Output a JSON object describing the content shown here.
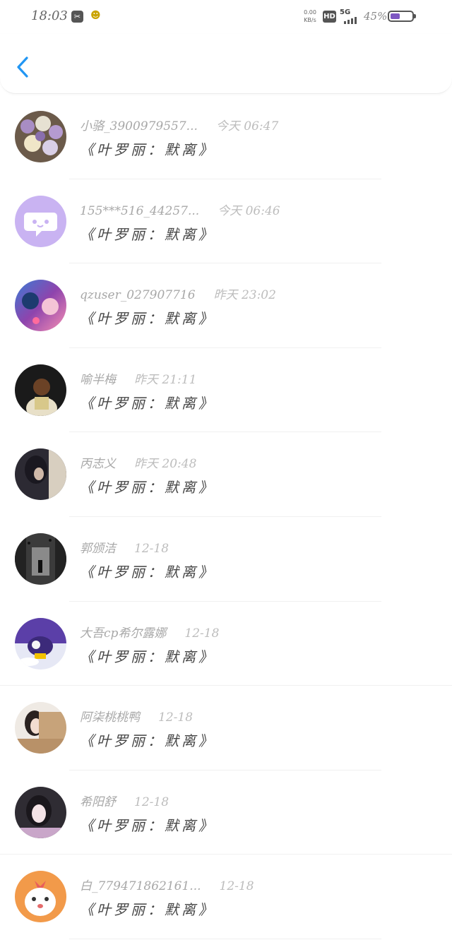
{
  "status_bar": {
    "time": "18:03",
    "network_speed": "0.00",
    "network_unit": "KB/s",
    "hd": "HD",
    "signal": "5G",
    "battery": "45%",
    "battery_level": 0.45
  },
  "header": {
    "back_icon": "chevron-left-icon",
    "accent_color": "#2196f3"
  },
  "messages": [
    {
      "name": "小骆_3900979557...",
      "time": "今天 06:47",
      "text": "《叶罗丽：默离》"
    },
    {
      "name": "155***516_44257...",
      "time": "今天 06:46",
      "text": "《叶罗丽：默离》"
    },
    {
      "name": "qzuser_027907716",
      "time": "昨天 23:02",
      "text": "《叶罗丽：默离》"
    },
    {
      "name": "喻半梅",
      "time": "昨天 21:11",
      "text": "《叶罗丽：默离》"
    },
    {
      "name": "丙志义",
      "time": "昨天 20:48",
      "text": "《叶罗丽：默离》"
    },
    {
      "name": "郭颁洁",
      "time": "12-18",
      "text": "《叶罗丽：默离》"
    },
    {
      "name": "大吾cp希尔露娜",
      "time": "12-18",
      "text": "《叶罗丽：默离》"
    },
    {
      "name": "阿柒桃桃鸭",
      "time": "12-18",
      "text": "《叶罗丽：默离》"
    },
    {
      "name": "希阳舒",
      "time": "12-18",
      "text": "《叶罗丽：默离》"
    },
    {
      "name": "白_779471862161...",
      "time": "12-18",
      "text": "《叶罗丽：默离》"
    }
  ]
}
